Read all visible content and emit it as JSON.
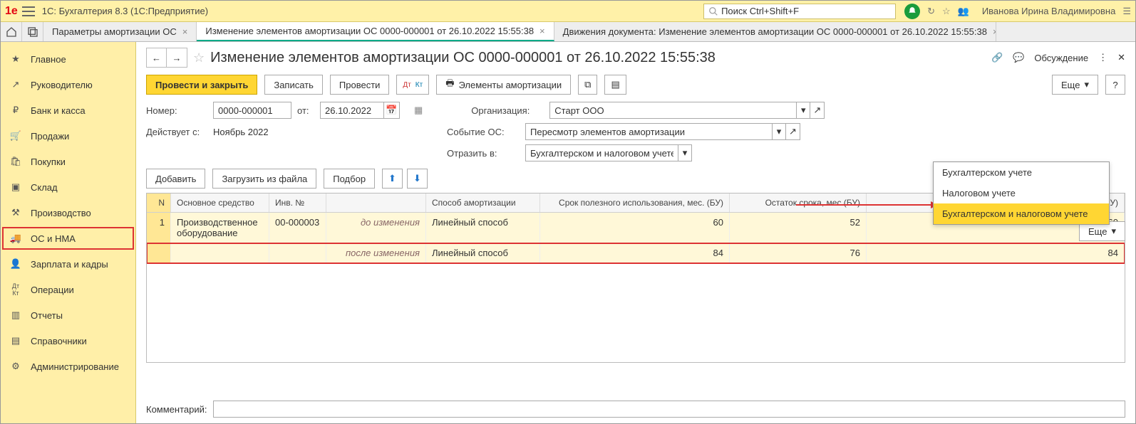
{
  "app": {
    "title": "1С: Бухгалтерия 8.3  (1С:Предприятие)"
  },
  "search": {
    "placeholder": "Поиск Ctrl+Shift+F"
  },
  "user": {
    "name": "Иванова Ирина Владимировна"
  },
  "tabs": [
    {
      "label": "Параметры амортизации ОС",
      "active": false
    },
    {
      "label": "Изменение элементов амортизации ОС 0000-000001 от 26.10.2022 15:55:38",
      "active": true
    },
    {
      "label": "Движения документа: Изменение элементов амортизации ОС 0000-000001 от 26.10.2022 15:55:38",
      "active": false
    }
  ],
  "sidebar": {
    "items": [
      {
        "label": "Главное",
        "icon": "★"
      },
      {
        "label": "Руководителю",
        "icon": "↗"
      },
      {
        "label": "Банк и касса",
        "icon": "₽"
      },
      {
        "label": "Продажи",
        "icon": "🛒"
      },
      {
        "label": "Покупки",
        "icon": "🛍"
      },
      {
        "label": "Склад",
        "icon": "📦"
      },
      {
        "label": "Производство",
        "icon": "🏭"
      },
      {
        "label": "ОС и НМА",
        "icon": "🚚",
        "selected": true
      },
      {
        "label": "Зарплата и кадры",
        "icon": "👤"
      },
      {
        "label": "Операции",
        "icon": "Дт/Кт"
      },
      {
        "label": "Отчеты",
        "icon": "📊"
      },
      {
        "label": "Справочники",
        "icon": "📘"
      },
      {
        "label": "Администрирование",
        "icon": "⚙"
      }
    ]
  },
  "page": {
    "title": "Изменение элементов амортизации ОС 0000-000001 от 26.10.2022 15:55:38",
    "discuss": "Обсуждение"
  },
  "toolbar": {
    "post_close": "Провести и закрыть",
    "save": "Записать",
    "post": "Провести",
    "elements": "Элементы амортизации",
    "more": "Еще",
    "help": "?"
  },
  "form": {
    "number_lbl": "Номер:",
    "number": "0000-000001",
    "from_lbl": "от:",
    "date": "26.10.2022",
    "valid_lbl": "Действует с:",
    "valid": "Ноябрь 2022",
    "org_lbl": "Организация:",
    "org": "Старт ООО",
    "event_lbl": "Событие ОС:",
    "event": "Пересмотр элементов амортизации",
    "reflect_lbl": "Отразить в:",
    "reflect": "Бухгалтерском и налоговом учете"
  },
  "table_toolbar": {
    "add": "Добавить",
    "load": "Загрузить из файла",
    "pick": "Подбор",
    "more": "Еще"
  },
  "grid": {
    "headers": {
      "n": "N",
      "os": "Основное средство",
      "inv": "Инв. №",
      "method": "Способ амортизации",
      "bu": "Срок полезного использования, мес. (БУ)",
      "rest": "Остаток срока, мес (БУ)",
      "nu": "Срок полезного использования, мес. (НУ)"
    },
    "change_labels": {
      "before": "до изменения",
      "after": "после изменения"
    },
    "rows": [
      {
        "n": 1,
        "os": "Производственное оборудование",
        "inv": "00-000003",
        "before": {
          "method": "Линейный способ",
          "bu": 60,
          "rest": 52,
          "nu": 60
        },
        "after": {
          "method": "Линейный способ",
          "bu": 84,
          "rest": 76,
          "nu": 84
        }
      }
    ]
  },
  "dropdown": {
    "items": [
      "Бухгалтерском учете",
      "Налоговом учете",
      "Бухгалтерском и налоговом учете"
    ],
    "selected": 2
  },
  "comment": {
    "label": "Комментарий:",
    "value": ""
  }
}
